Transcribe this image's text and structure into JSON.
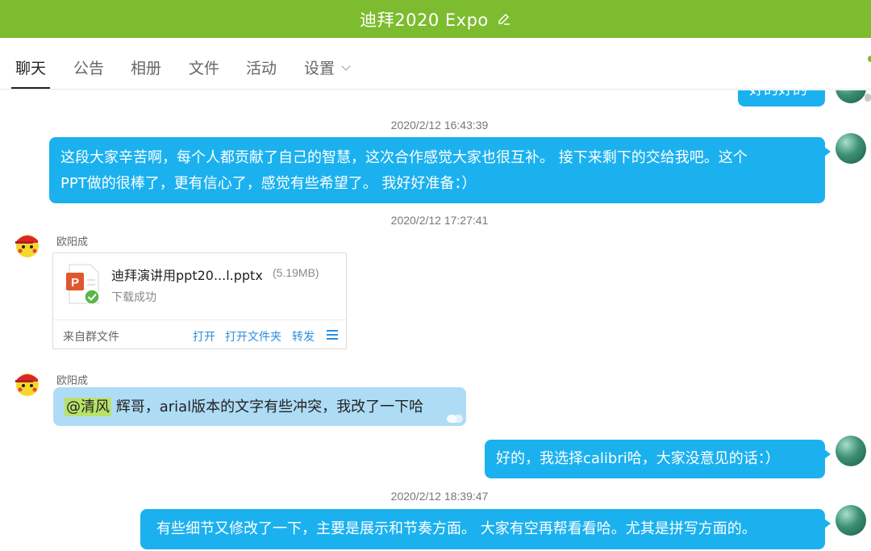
{
  "window": {
    "title": "迪拜2020 Expo",
    "accent_color": "#7dbb2f",
    "edit_icon": "pencil-icon"
  },
  "tabs": [
    {
      "label": "聊天",
      "active": true
    },
    {
      "label": "公告",
      "active": false
    },
    {
      "label": "相册",
      "active": false
    },
    {
      "label": "文件",
      "active": false
    },
    {
      "label": "活动",
      "active": false
    },
    {
      "label": "设置",
      "active": false,
      "has_dropdown": true
    }
  ],
  "messages": {
    "partial_top_text": "好的好的",
    "ts1": "2020/2/12 16:43:39",
    "msg1_line1": "这段大家辛苦啊，每个人都贡献了自己的智慧，这次合作感觉大家也很互补。 接下来剩下的交给我吧。这个",
    "msg1_line2": "PPT做的很棒了，更有信心了，感觉有些希望了。 我好好准备：）",
    "ts2": "2020/2/12 17:27:41",
    "sender1": "欧阳成",
    "file": {
      "name": "迪拜演讲用ppt20...l.pptx",
      "size": "(5.19MB)",
      "status": "下载成功",
      "source": "来自群文件",
      "actions": [
        "打开",
        "打开文件夹",
        "转发"
      ]
    },
    "sender2": "欧阳成",
    "msg2_mention": "@清风",
    "msg2_text": " 辉哥，arial版本的文字有些冲突，我改了一下哈",
    "msg3": "好的，我选择calibri哈，大家没意见的话：）",
    "ts3": "2020/2/12 18:39:47",
    "msg4": "有些细节又修改了一下，主要是展示和节奏方面。 大家有空再帮看看哈。尤其是拼写方面的。"
  },
  "colors": {
    "bubble_self": "#1bb1ef",
    "bubble_other": "#aedcf5",
    "mention_highlight": "#b8e26a",
    "link": "#2a8ee0"
  }
}
